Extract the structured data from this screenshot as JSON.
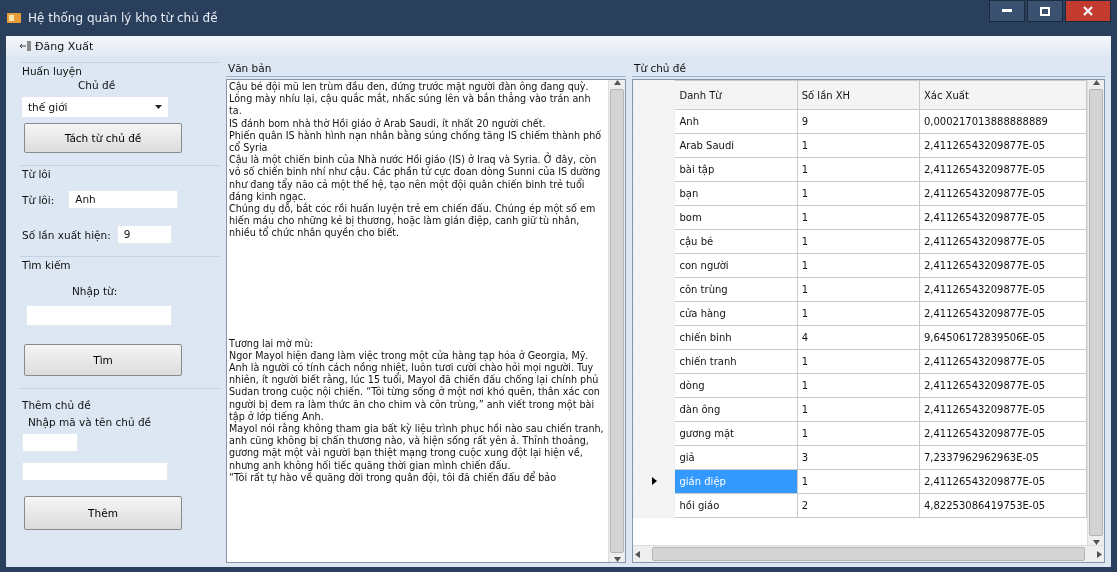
{
  "window": {
    "title": "Hệ thống quản lý kho từ chủ đề"
  },
  "menu": {
    "items": [
      {
        "label": "Đăng Xuất"
      }
    ]
  },
  "training": {
    "title": "Huấn luyện",
    "topic_label": "Chủ đề",
    "topic_value": "thế giới",
    "button": "Tách từ chủ đề"
  },
  "word": {
    "title": "Từ lôi",
    "word_label": "Từ lôi:",
    "word_value": "Anh",
    "count_label": "Số lần xuất hiện:",
    "count_value": "9"
  },
  "search": {
    "title": "Tìm kiếm",
    "label": "Nhập từ:",
    "button": "Tìm"
  },
  "add_topic": {
    "title": "Thêm chủ đề",
    "label": "Nhập mã và tên chủ đề",
    "button": "Thêm"
  },
  "text_panel": {
    "title": "Văn bản",
    "blocks": [
      {
        "paragraphs": [
          "Cậu bé đội mũ len trùm đầu đen, đứng trước mặt người đàn ông đang quỳ. Lông mày nhíu lại, cậu quắc mắt, nhấc súng lên và bắn thẳng vào trán anh ta.",
          "IS đánh bom nhà thờ Hồi giáo ở Arab Saudi, ít nhất 20 người chết.",
          "Phiến quân IS hành hình nạn nhân bằng súng chống tăng IS chiếm thành phố cổ Syria",
          "Cậu là một chiến binh của Nhà nước Hồi giáo (IS) ở Iraq và Syria. Ở đây, còn vô số chiến binh nhí như cậu. Các phần tử cực đoan dòng Sunni của IS dường như đang tẩy não cả một thế hệ, tạo nên một đội quân chiến binh trẻ tuổi đáng kinh ngạc.",
          "Chúng dụ dỗ, bắt cóc rồi huấn luyện trẻ em chiến đấu. Chúng ép một số em hiến máu cho những kẻ bị thương, hoặc làm gián điệp, canh giữ tù nhân, nhiều tổ chức nhân quyền cho biết."
        ]
      },
      {
        "paragraphs": [
          "Tương lai mờ mù:",
          "Ngor Mayol hiện đang làm việc trong một cửa hàng tạp hóa ở Georgia, Mỹ. Anh là người có tính cách nồng nhiệt, luôn tươi cười chào hỏi mọi người. Tuy nhiên, ít người biết rằng, lúc 15 tuổi, Mayol đã chiến đấu chống lại chính phủ Sudan trong cuộc nội chiến. “Tôi từng sống ở một nơi khó quên, thân xác con người bị đem ra làm thức ăn cho chim và côn trùng,” anh viết trong một bài tập ở lớp tiếng Anh.",
          "Mayol nói rằng không tham gia bất kỳ liệu trình phục hồi nào sau chiến tranh, anh cũng không bị chấn thương nào, và hiện sống rất yên ả. Thỉnh thoảng, gương mặt một vài người bạn thiệt mạng trong cuộc xung đột lại hiện về, nhưng anh không hối tiếc quãng thời gian mình chiến đấu.",
          "“Tôi rất tự hào về quãng đời trong quân đội, tôi đã chiến đấu để bảo"
        ]
      }
    ]
  },
  "table_panel": {
    "title": "Từ chủ đề",
    "columns": [
      "Danh Từ",
      "Số lần XH",
      "Xác Xuất"
    ],
    "rows": [
      {
        "cells": [
          "Anh",
          "9",
          "0,000217013888888889"
        ],
        "selected": false
      },
      {
        "cells": [
          "Arab Saudi",
          "1",
          "2,41126543209877E-05"
        ],
        "selected": false
      },
      {
        "cells": [
          "bài tập",
          "1",
          "2,41126543209877E-05"
        ],
        "selected": false
      },
      {
        "cells": [
          "bạn",
          "1",
          "2,41126543209877E-05"
        ],
        "selected": false
      },
      {
        "cells": [
          "bom",
          "1",
          "2,41126543209877E-05"
        ],
        "selected": false
      },
      {
        "cells": [
          "cậu bé",
          "1",
          "2,41126543209877E-05"
        ],
        "selected": false
      },
      {
        "cells": [
          "con người",
          "1",
          "2,41126543209877E-05"
        ],
        "selected": false
      },
      {
        "cells": [
          "côn trùng",
          "1",
          "2,41126543209877E-05"
        ],
        "selected": false
      },
      {
        "cells": [
          "cửa hàng",
          "1",
          "2,41126543209877E-05"
        ],
        "selected": false
      },
      {
        "cells": [
          "chiến binh",
          "4",
          "9,64506172839506E-05"
        ],
        "selected": false
      },
      {
        "cells": [
          "chiến tranh",
          "1",
          "2,41126543209877E-05"
        ],
        "selected": false
      },
      {
        "cells": [
          "dòng",
          "1",
          "2,41126543209877E-05"
        ],
        "selected": false
      },
      {
        "cells": [
          "đàn ông",
          "1",
          "2,41126543209877E-05"
        ],
        "selected": false
      },
      {
        "cells": [
          "gương mặt",
          "1",
          "2,41126543209877E-05"
        ],
        "selected": false
      },
      {
        "cells": [
          "giả",
          "3",
          "7,2337962962963E-05"
        ],
        "selected": false
      },
      {
        "cells": [
          "gián điệp",
          "1",
          "2,41126543209877E-05"
        ],
        "selected": true
      },
      {
        "cells": [
          "hồi giáo",
          "2",
          "4,82253086419753E-05"
        ],
        "selected": false
      }
    ]
  }
}
